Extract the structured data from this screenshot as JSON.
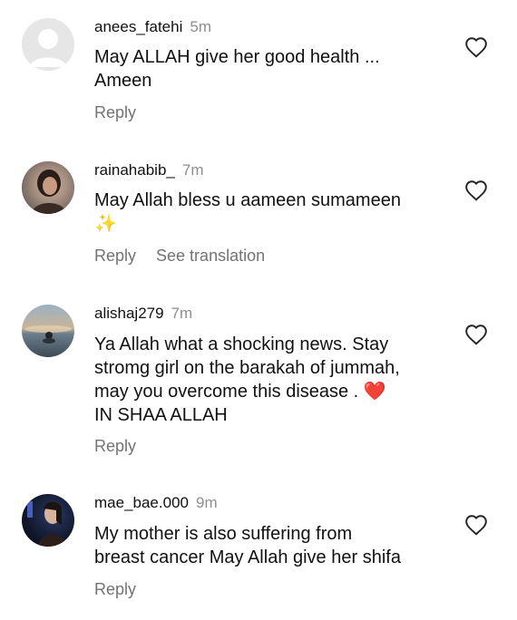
{
  "comments": [
    {
      "username": "anees_fatehi",
      "time": "5m",
      "lines": [
        "May ALLAH give her good health ...",
        "Ameen"
      ],
      "reply": "Reply"
    },
    {
      "username": "rainahabib_",
      "time": "7m",
      "lines": [
        "May Allah bless u aameen sumameen",
        "✨"
      ],
      "reply": "Reply",
      "translate": "See translation"
    },
    {
      "username": "alishaj279",
      "time": "7m",
      "lines": [
        "Ya Allah what a shocking news.  Stay",
        "stromg girl on the barakah of jummah,",
        "may you overcome this disease . ❤️",
        "IN SHAA ALLAH"
      ],
      "reply": "Reply"
    },
    {
      "username": "mae_bae.000",
      "time": "9m",
      "lines": [
        "My mother is also suffering from",
        "breast cancer May Allah give her shifa"
      ],
      "reply": "Reply"
    }
  ],
  "icons": {
    "heart": "heart-outline-icon",
    "avatar_default": "default-user-icon"
  },
  "colors": {
    "text": "#111111",
    "muted": "#8e8e8e",
    "action": "#737373"
  }
}
